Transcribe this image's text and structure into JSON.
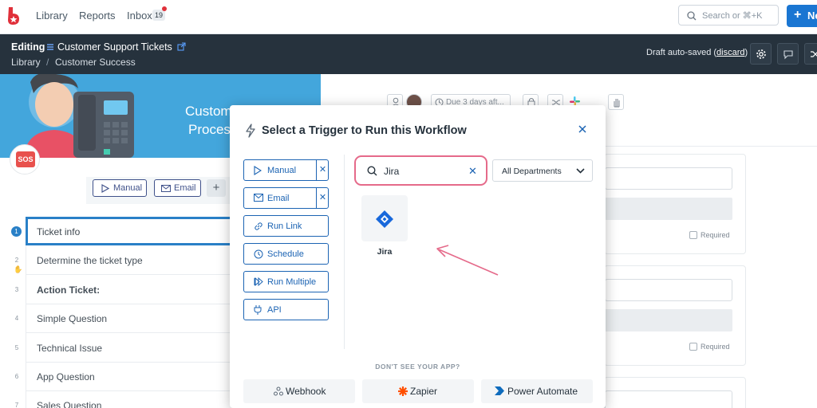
{
  "topnav": {
    "library": "Library",
    "reports": "Reports",
    "inbox": "Inbox",
    "inbox_count": "19",
    "search_placeholder": "Search or ⌘+K",
    "new_label": "Ne"
  },
  "editbar": {
    "editing_label": "Editing",
    "workflow_title": "Customer Support Tickets",
    "breadcrumb_root": "Library",
    "breadcrumb_sep": "/",
    "breadcrumb_folder": "Customer Success",
    "draft_text": "Draft auto-saved (",
    "discard": "discard",
    "draft_close": ")"
  },
  "hero": {
    "title_line1": "Custom",
    "title_line2": "Proces",
    "sos": "SOS"
  },
  "bg_triggers": {
    "manual": "Manual",
    "email": "Email",
    "add": "+"
  },
  "steps": [
    {
      "num": "1",
      "label": "Ticket info"
    },
    {
      "num": "2",
      "label": "Determine the ticket type"
    },
    {
      "num": "3",
      "label": "Action Ticket:"
    },
    {
      "num": "4",
      "label": "Simple Question"
    },
    {
      "num": "5",
      "label": "Technical Issue"
    },
    {
      "num": "6",
      "label": "App Question"
    },
    {
      "num": "7",
      "label": "Sales Question"
    }
  ],
  "bg_toolbar": {
    "due": "Due 3 days aft..."
  },
  "right_cards": {
    "required": "Required"
  },
  "modal": {
    "title": "Select a Trigger to Run this Workflow",
    "triggers": [
      {
        "label": "Manual",
        "icon": "play-icon",
        "removable": true
      },
      {
        "label": "Email",
        "icon": "mail-icon",
        "removable": true
      },
      {
        "label": "Run Link",
        "icon": "link-icon",
        "removable": false
      },
      {
        "label": "Schedule",
        "icon": "clock-icon",
        "removable": false
      },
      {
        "label": "Run Multiple",
        "icon": "fast-forward-icon",
        "removable": false
      },
      {
        "label": "API",
        "icon": "plug-icon",
        "removable": false
      }
    ],
    "search_value": "Jira",
    "department": "All Departments",
    "app_result": "Jira",
    "dont_see": "DON'T SEE YOUR APP?",
    "alt_apps": [
      "Webhook",
      "Zapier",
      "Power Automate"
    ]
  },
  "colors": {
    "accent": "#1b63b3",
    "highlight": "#e56a8a",
    "editbar_bg": "#26323d",
    "new_button": "#1a76d2"
  }
}
